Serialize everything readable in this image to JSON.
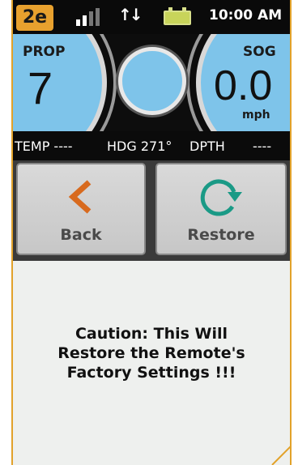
{
  "status_bar": {
    "badge": "2e",
    "time": "10:00 AM",
    "signal_icon": "signal-bars-icon",
    "data_icon": "data-arrows-icon",
    "battery_icon": "battery-icon"
  },
  "gauges": {
    "prop_label": "PROP",
    "prop_value": "7",
    "sog_label": "SOG",
    "sog_value": "0.0",
    "sog_unit": "mph"
  },
  "info_strip": {
    "temp": "TEMP ----",
    "hdg": "HDG 271°",
    "dpth": "DPTH",
    "dpth_value": "----"
  },
  "buttons": {
    "back_label": "Back",
    "restore_label": "Restore"
  },
  "caution": {
    "line1": "Caution: This Will",
    "line2": "Restore the Remote's",
    "line3": "Factory Settings !!!"
  },
  "colors": {
    "accent": "#e8a12e",
    "gauge_blue": "#7ec4ea",
    "back_arrow": "#d86a1e",
    "restore_arrow": "#1a9a86"
  }
}
